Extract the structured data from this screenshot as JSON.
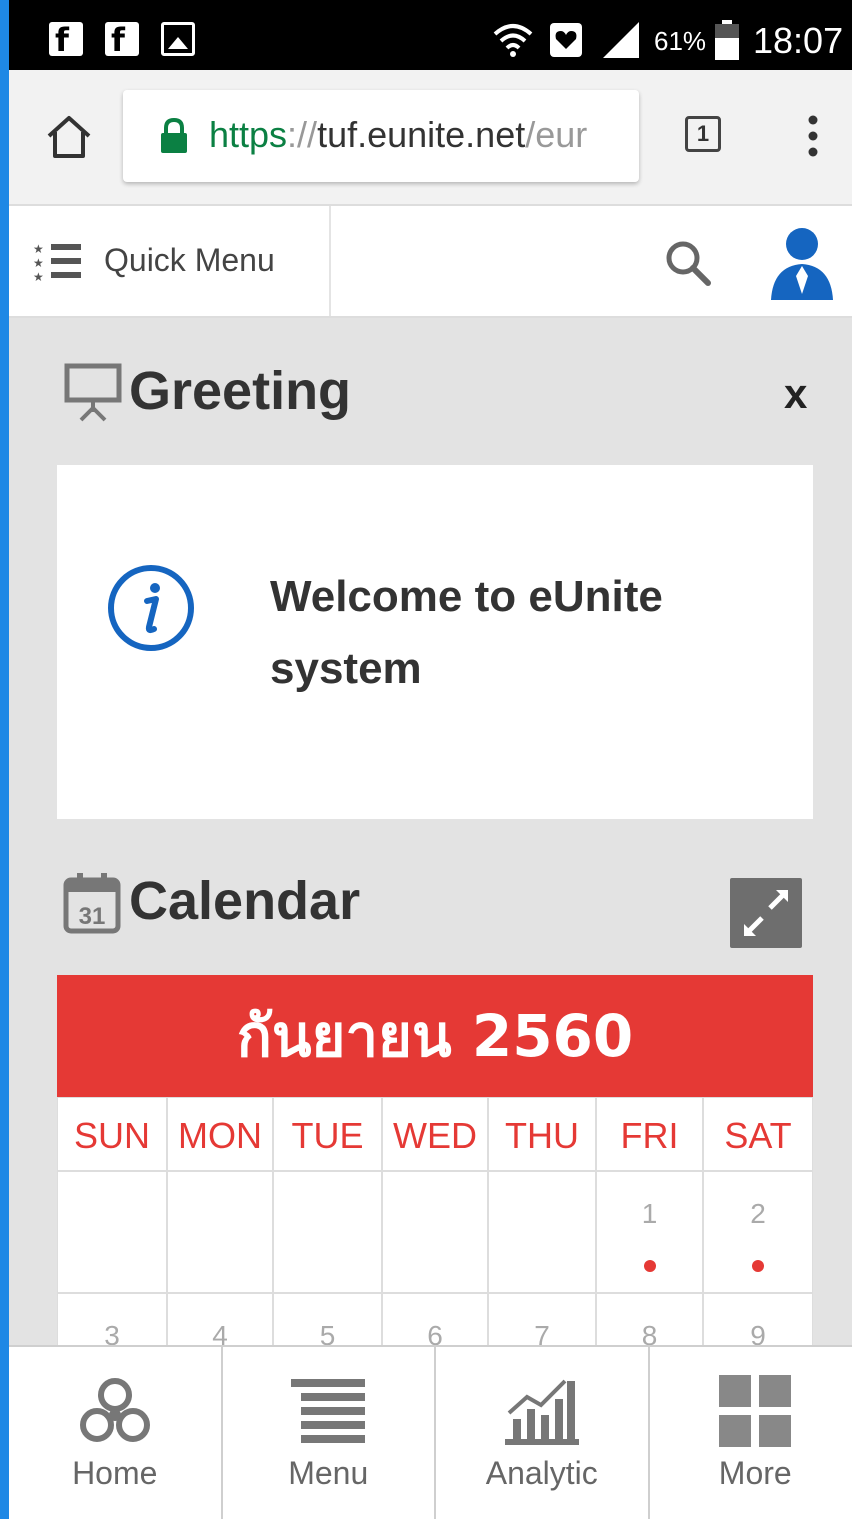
{
  "status_bar": {
    "notification_icons": [
      "facebook-icon",
      "facebook-icon",
      "image-icon"
    ],
    "battery_percent": "61%",
    "time": "18:07"
  },
  "browser": {
    "url_scheme": "https",
    "url_sep": "://",
    "url_host": "tuf.eunite.net",
    "url_tail": "/eur",
    "tab_count": "1"
  },
  "header": {
    "quick_menu_label": "Quick Menu"
  },
  "greeting": {
    "title": "Greeting",
    "close_label": "x",
    "message": "Welcome to eUnite system"
  },
  "calendar": {
    "title": "Calendar",
    "month_year": "กันยายน 2560",
    "weekdays": [
      "SUN",
      "MON",
      "TUE",
      "WED",
      "THU",
      "FRI",
      "SAT"
    ],
    "rows": [
      [
        "",
        "",
        "",
        "",
        "",
        "1",
        "2"
      ],
      [
        "3",
        "4",
        "5",
        "6",
        "7",
        "8",
        "9"
      ]
    ],
    "event_days": [
      "1",
      "2"
    ],
    "accent_color": "#e53935"
  },
  "bottom_nav": {
    "items": [
      {
        "label": "Home",
        "icon": "triskelion-icon"
      },
      {
        "label": "Menu",
        "icon": "menu-lines-icon"
      },
      {
        "label": "Analytic",
        "icon": "bar-chart-icon"
      },
      {
        "label": "More",
        "icon": "grid-icon"
      }
    ]
  }
}
